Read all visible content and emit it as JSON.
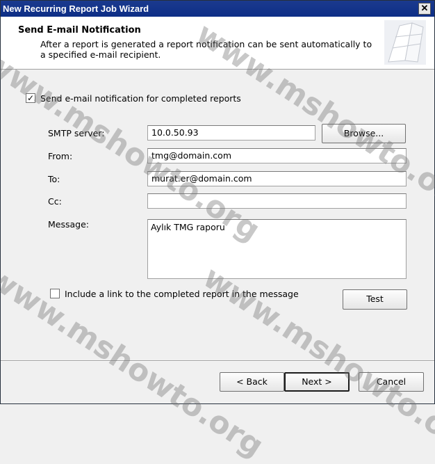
{
  "window": {
    "title": "New Recurring Report Job Wizard",
    "close_glyph": "✕"
  },
  "header": {
    "title": "Send E-mail Notification",
    "description": "After a report is generated a report notification can be sent automatically to a specified e-mail recipient."
  },
  "form": {
    "send_notification": {
      "label": "Send e-mail notification for completed reports",
      "checked": true,
      "glyph": "✓"
    },
    "smtp_server": {
      "label": "SMTP server:",
      "value": "10.0.50.93"
    },
    "browse_label": "Browse...",
    "from": {
      "label": "From:",
      "value": "tmg@domain.com"
    },
    "to": {
      "label": "To:",
      "value": "murat.er@domain.com"
    },
    "cc": {
      "label": "Cc:",
      "value": ""
    },
    "message": {
      "label": "Message:",
      "value": "Aylık TMG raporu"
    },
    "include_link": {
      "label": "Include a link to the completed report in the message",
      "checked": false
    },
    "test_label": "Test"
  },
  "footer": {
    "back_label": "< Back",
    "next_label": "Next >",
    "cancel_label": "Cancel"
  },
  "watermark": {
    "text": "www.mshowto.org"
  }
}
